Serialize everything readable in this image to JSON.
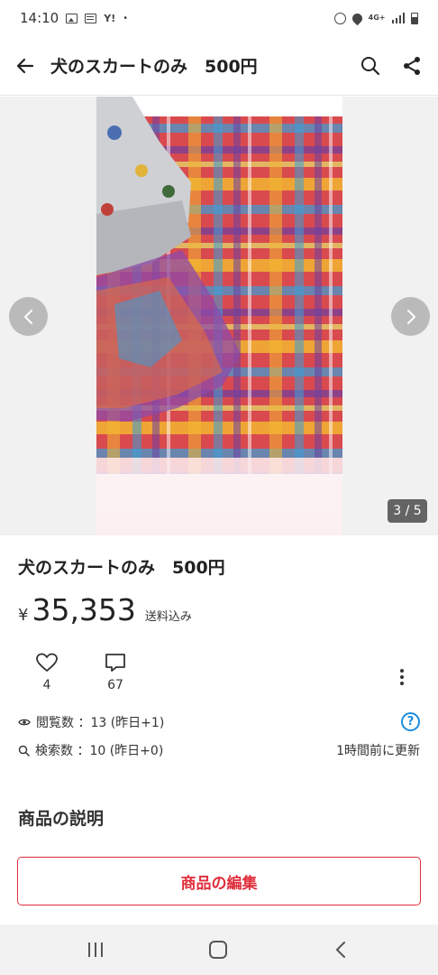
{
  "status_bar": {
    "time": "14:10",
    "yahoo_label": "Y!",
    "network": "4G+",
    "icons": [
      "image-icon",
      "card-icon",
      "alarm-icon",
      "location-icon",
      "signal-icon",
      "battery-icon"
    ]
  },
  "header": {
    "title": "犬のスカートのみ　500円"
  },
  "gallery": {
    "counter": "3 / 5",
    "current_index": 3,
    "total": 5
  },
  "product": {
    "title": "犬のスカートのみ　500円",
    "currency": "¥",
    "price": "35,353",
    "shipping": "送料込み",
    "likes": "4",
    "comments": "67"
  },
  "stats": {
    "views": "閲覧数 ：13 (昨日+1)",
    "searches": "検索数 ：10 (昨日+0)",
    "updated": "1時間前に更新",
    "help_glyph": "?"
  },
  "description": {
    "title": "商品の説明"
  },
  "edit_button": {
    "label": "商品の編集"
  },
  "colors": {
    "accent": "#e02e3c",
    "help": "#1b8de0"
  }
}
